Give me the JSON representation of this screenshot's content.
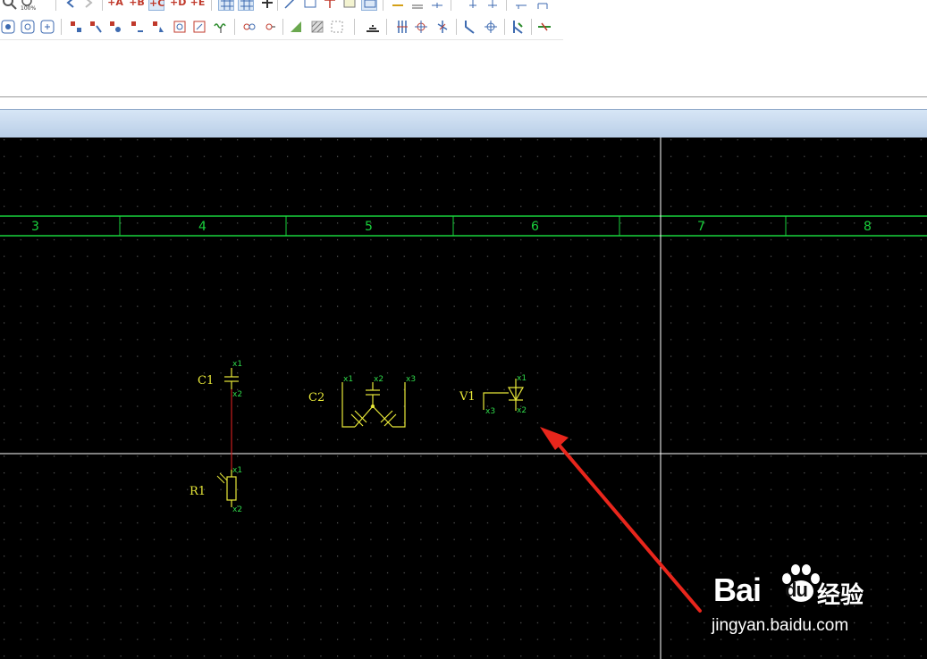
{
  "toolbar": {
    "row1": [
      "zoom-in",
      "zoom-100",
      "",
      "undo",
      "redo",
      "",
      "+A",
      "+B",
      "+C",
      "+D",
      "+E",
      "",
      "grid-snap-1",
      "grid-snap-2",
      "insert-node",
      "insert-wire",
      "insert-rect",
      "insert-text",
      "insert-picture",
      "select-frame",
      "",
      "macro-1",
      "macro-2",
      "macro-3",
      "",
      "move-1",
      "move-2",
      "",
      "place-1",
      "place-2"
    ],
    "row2_icons": [
      "device-select",
      "device-props",
      "device-replace",
      "",
      "connector-1",
      "connector-2",
      "connector-3",
      "connector-4",
      "connector-5",
      "connector-6",
      "connector-7",
      "spring",
      "",
      "terminal-1",
      "terminal-2",
      "",
      "fill-solid",
      "fill-hatch",
      "fill-none",
      "",
      "insert-graphic",
      "",
      "cable-1",
      "cable-2",
      "cable-3",
      "",
      "angle-1",
      "angle-2",
      "",
      "bridge-1",
      "",
      "wire-break"
    ]
  },
  "canvas": {
    "columns": [
      "3",
      "4",
      "5",
      "6",
      "7",
      "8"
    ],
    "parts": {
      "c1": {
        "label": "C1",
        "pins": [
          "x1",
          "x2"
        ]
      },
      "c2": {
        "label": "C2",
        "pins": [
          "x1",
          "x2",
          "x3"
        ]
      },
      "v1": {
        "label": "V1",
        "pins": [
          "x1",
          "x2",
          "x3"
        ]
      },
      "r1": {
        "label": "R1",
        "pins": [
          "x1",
          "x2"
        ]
      }
    }
  },
  "colors": {
    "background": "#000000",
    "grid_dot": "#5a5a5a",
    "column_bar": "#19d23c",
    "symbol": "#e8e838",
    "pin_label": "#2fd84a",
    "wire": "#c81e1e",
    "crosshair": "#ffffff",
    "annotation_arrow": "#e8261c"
  },
  "watermark": {
    "brand": "Bai",
    "brand_suffix": "du",
    "cn": "经验",
    "url": "jingyan.baidu.com"
  }
}
